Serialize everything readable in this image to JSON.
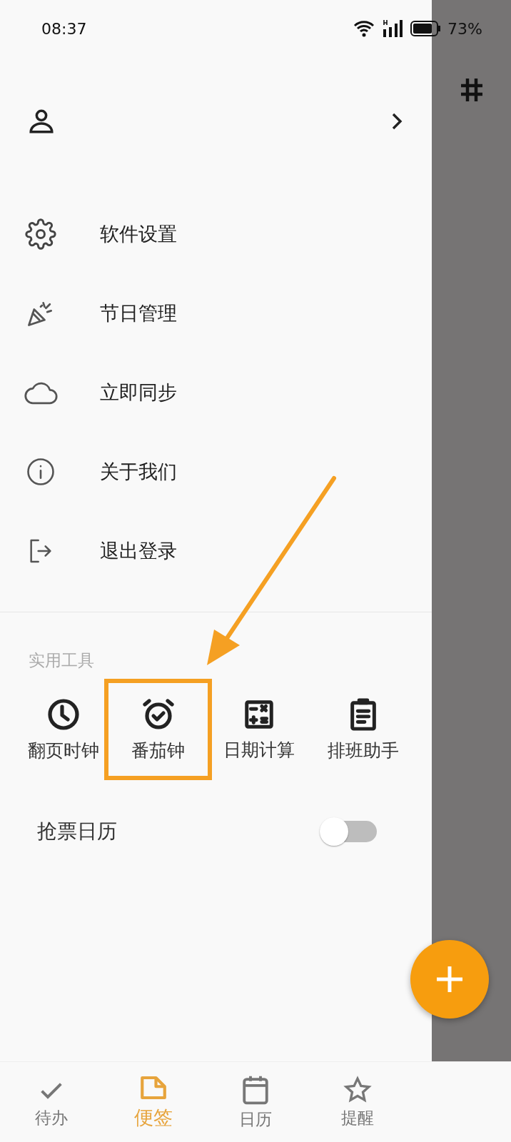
{
  "status_bar": {
    "time": "08:37",
    "battery": "73%"
  },
  "menu": [
    {
      "kind": "settings",
      "label": "软件设置"
    },
    {
      "kind": "party",
      "label": "节日管理"
    },
    {
      "kind": "cloud",
      "label": "立即同步"
    },
    {
      "kind": "info",
      "label": "关于我们"
    },
    {
      "kind": "logout",
      "label": "退出登录"
    }
  ],
  "tools": {
    "title": "实用工具",
    "items": [
      {
        "kind": "clock",
        "label": "翻页时钟",
        "highlighted": false
      },
      {
        "kind": "alarm",
        "label": "番茄钟",
        "highlighted": true
      },
      {
        "kind": "calc",
        "label": "日期计算",
        "highlighted": false
      },
      {
        "kind": "clipboard",
        "label": "排班助手",
        "highlighted": false
      }
    ]
  },
  "toggle_row": {
    "label": "抢票日历",
    "on": false
  },
  "annotations": [
    {
      "kind": "arrow"
    }
  ],
  "tabs": [
    {
      "kind": "check",
      "label": "待办",
      "selected": false
    },
    {
      "kind": "note",
      "label": "便签",
      "selected": true
    },
    {
      "kind": "calendar",
      "label": "日历",
      "selected": false
    },
    {
      "kind": "star",
      "label": "提醒",
      "selected": false
    }
  ]
}
